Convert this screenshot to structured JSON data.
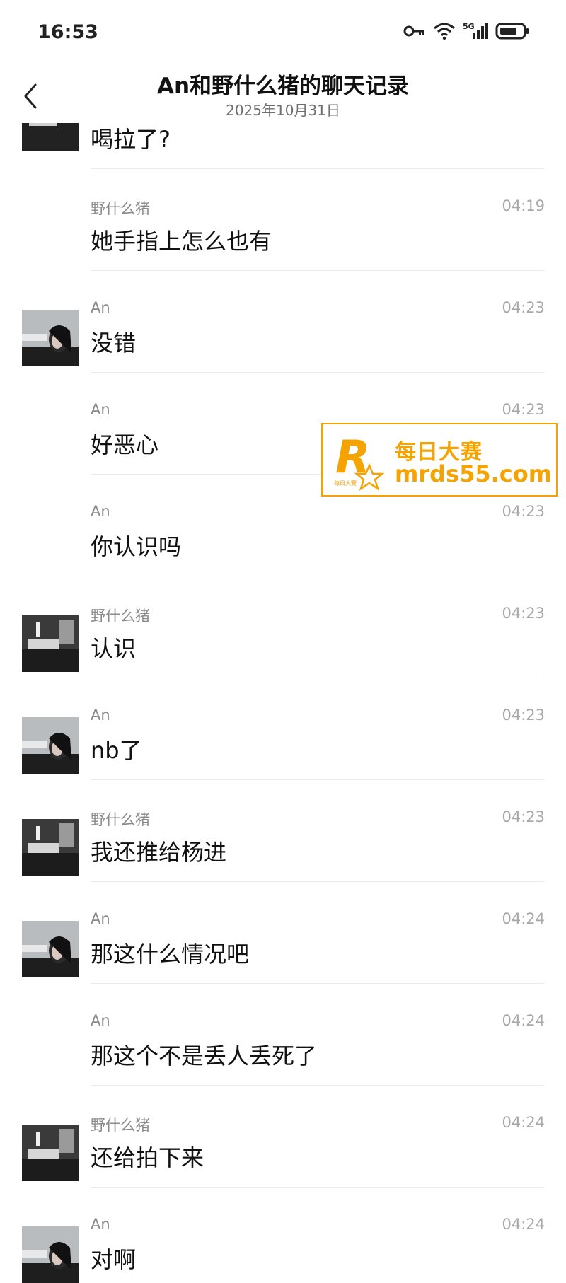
{
  "status_bar": {
    "time": "16:53",
    "network": "5G"
  },
  "header": {
    "title": "An和野什么猪的聊天记录",
    "date": "2025年10月31日"
  },
  "first_message": {
    "text": "喝拉了?"
  },
  "messages": [
    {
      "sender": "野什么猪",
      "time": "04:19",
      "text": "她手指上怎么也有",
      "avatar": ""
    },
    {
      "sender": "An",
      "time": "04:23",
      "text": "没错",
      "avatar": "an"
    },
    {
      "sender": "An",
      "time": "04:23",
      "text": "好恶心",
      "avatar": ""
    },
    {
      "sender": "An",
      "time": "04:23",
      "text": "你认识吗",
      "avatar": ""
    },
    {
      "sender": "野什么猪",
      "time": "04:23",
      "text": "认识",
      "avatar": "pig"
    },
    {
      "sender": "An",
      "time": "04:23",
      "text": "nb了",
      "avatar": "an"
    },
    {
      "sender": "野什么猪",
      "time": "04:23",
      "text": "我还推给杨进",
      "avatar": "pig"
    },
    {
      "sender": "An",
      "time": "04:24",
      "text": "那这什么情况吧",
      "avatar": "an"
    },
    {
      "sender": "An",
      "time": "04:24",
      "text": "那这个不是丢人丢死了",
      "avatar": ""
    },
    {
      "sender": "野什么猪",
      "time": "04:24",
      "text": "还给拍下来",
      "avatar": "pig"
    },
    {
      "sender": "An",
      "time": "04:24",
      "text": "对啊",
      "avatar": "an"
    }
  ],
  "watermark": {
    "line1": "每日大赛",
    "line2": "mrds55.com",
    "logo_letter": "R",
    "logo_small": "每日大赛",
    "color": "#f5a300"
  },
  "colors": {
    "sender": "#8a8a8a",
    "time": "#a8a8a8",
    "divider": "#ececec"
  }
}
